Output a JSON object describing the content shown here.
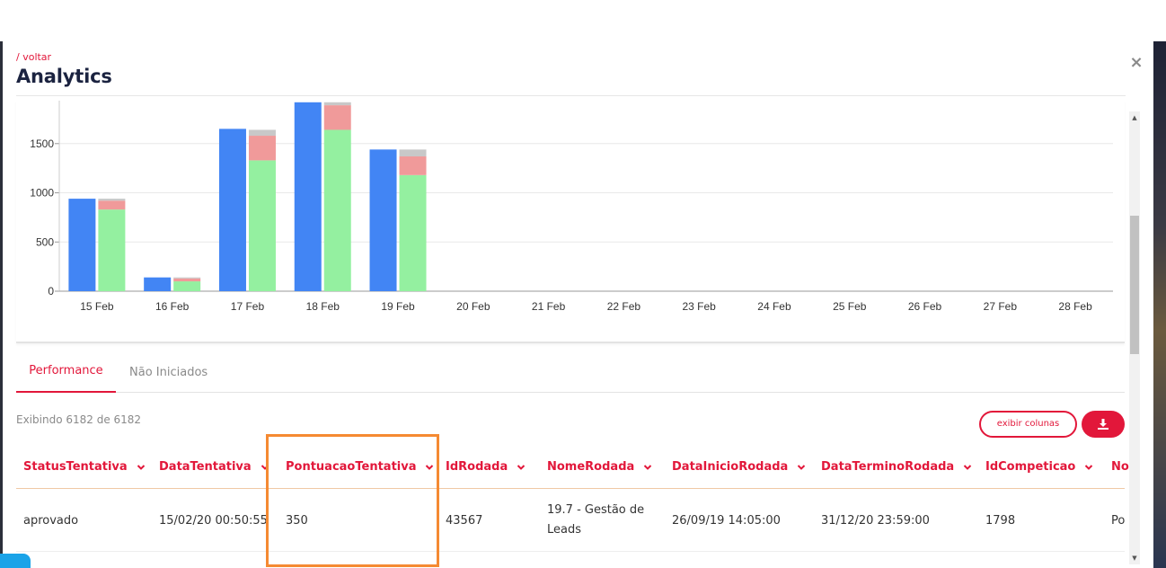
{
  "header": {
    "back_label": "/ voltar",
    "title": "Analytics",
    "close_label": "×"
  },
  "colors": {
    "accent": "#e2173a",
    "series_blue": "#4285f4",
    "series_green": "#94f0a0",
    "series_red": "#f09a9a",
    "series_gray": "#c8c8c8",
    "highlight": "#f58a32"
  },
  "chart_data": {
    "type": "bar",
    "categories": [
      "15 Feb",
      "16 Feb",
      "17 Feb",
      "18 Feb",
      "19 Feb",
      "20 Feb",
      "21 Feb",
      "22 Feb",
      "23 Feb",
      "24 Feb",
      "25 Feb",
      "26 Feb",
      "27 Feb",
      "28 Feb"
    ],
    "ylim": [
      0,
      1900
    ],
    "yticks": [
      0,
      500,
      1000,
      1500
    ],
    "grid": true,
    "stacked_second_bar": true,
    "series": [
      {
        "color": "#4285f4",
        "stack": "a",
        "values": [
          940,
          140,
          1650,
          1920,
          1440,
          0,
          0,
          0,
          0,
          0,
          0,
          0,
          0,
          0
        ]
      },
      {
        "color": "#94f0a0",
        "stack": "b",
        "values": [
          830,
          100,
          1330,
          1640,
          1180,
          0,
          0,
          0,
          0,
          0,
          0,
          0,
          0,
          0
        ]
      },
      {
        "color": "#f09a9a",
        "stack": "b",
        "values": [
          90,
          30,
          250,
          250,
          190,
          0,
          0,
          0,
          0,
          0,
          0,
          0,
          0,
          0
        ]
      },
      {
        "color": "#c8c8c8",
        "stack": "b",
        "values": [
          20,
          10,
          60,
          30,
          70,
          0,
          0,
          0,
          0,
          0,
          0,
          0,
          0,
          0
        ]
      }
    ],
    "title": "",
    "xlabel": "",
    "ylabel": ""
  },
  "tabs": [
    {
      "label": "Performance",
      "active": true
    },
    {
      "label": "Não Iniciados",
      "active": false
    }
  ],
  "table": {
    "count_text": "Exibindo 6182 de 6182",
    "columns_button": "exibir colunas",
    "download_icon": "download-icon",
    "columns": [
      "StatusTentativa",
      "DataTentativa",
      "PontuacaoTentativa",
      "IdRodada",
      "NomeRodada",
      "DataInicioRodada",
      "DataTerminoRodada",
      "IdCompeticao",
      "No"
    ],
    "rows": [
      [
        "aprovado",
        "15/02/20 00:50:55",
        "350",
        "43567",
        "19.7 - Gestão de Leads",
        "26/09/19 14:05:00",
        "31/12/20 23:59:00",
        "1798",
        "Po"
      ]
    ]
  }
}
